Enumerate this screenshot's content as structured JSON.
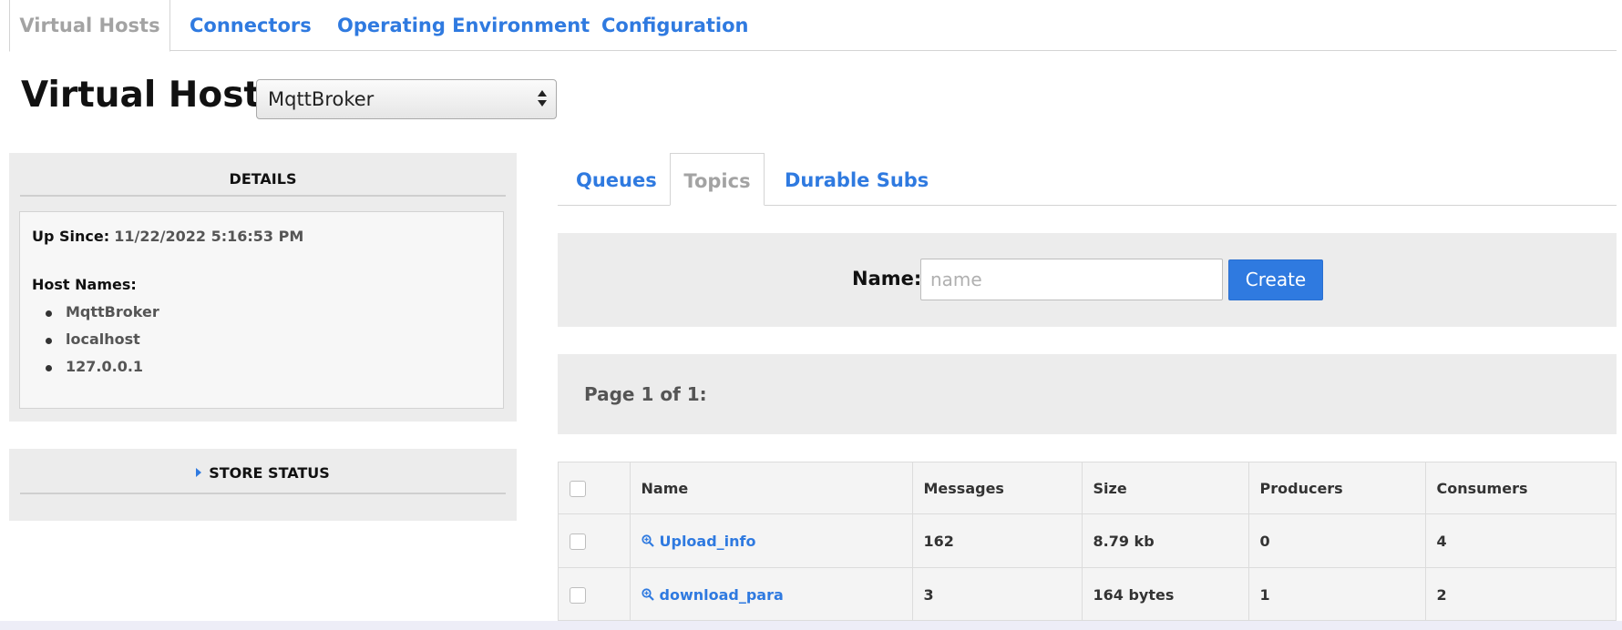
{
  "top_tabs": [
    {
      "label": "Virtual Hosts",
      "active": true
    },
    {
      "label": "Connectors",
      "active": false
    },
    {
      "label": "Operating Environment",
      "active": false
    },
    {
      "label": "Configuration",
      "active": false
    }
  ],
  "virtual_host": {
    "title": "Virtual Host:",
    "selected": "MqttBroker"
  },
  "details": {
    "heading": "DETAILS",
    "up_since_label": "Up Since:",
    "up_since_value": "11/22/2022 5:16:53 PM",
    "host_names_label": "Host Names:",
    "host_names": [
      "MqttBroker",
      "localhost",
      "127.0.0.1"
    ]
  },
  "store_status": {
    "heading": "STORE STATUS"
  },
  "sub_tabs": [
    {
      "label": "Queues",
      "active": false
    },
    {
      "label": "Topics",
      "active": true
    },
    {
      "label": "Durable Subs",
      "active": false
    }
  ],
  "create": {
    "name_label": "Name:",
    "placeholder": "name",
    "value": "",
    "button_label": "Create"
  },
  "pager": {
    "text": "Page 1 of 1:"
  },
  "table": {
    "columns": [
      "Name",
      "Messages",
      "Size",
      "Producers",
      "Consumers"
    ],
    "rows": [
      {
        "name": "Upload_info",
        "messages": "162",
        "size": "8.79 kb",
        "producers": "0",
        "consumers": "4"
      },
      {
        "name": "download_para",
        "messages": "3",
        "size": "164 bytes",
        "producers": "1",
        "consumers": "2"
      }
    ]
  },
  "colors": {
    "accent": "#2f7ae0",
    "panel_bg": "#ececec",
    "inactive_tab": "#a3a3a3"
  },
  "icons": {
    "row_link": "zoom-in-icon",
    "select_arrows": "up-down-arrows-icon",
    "collapse": "triangle-right-icon"
  }
}
